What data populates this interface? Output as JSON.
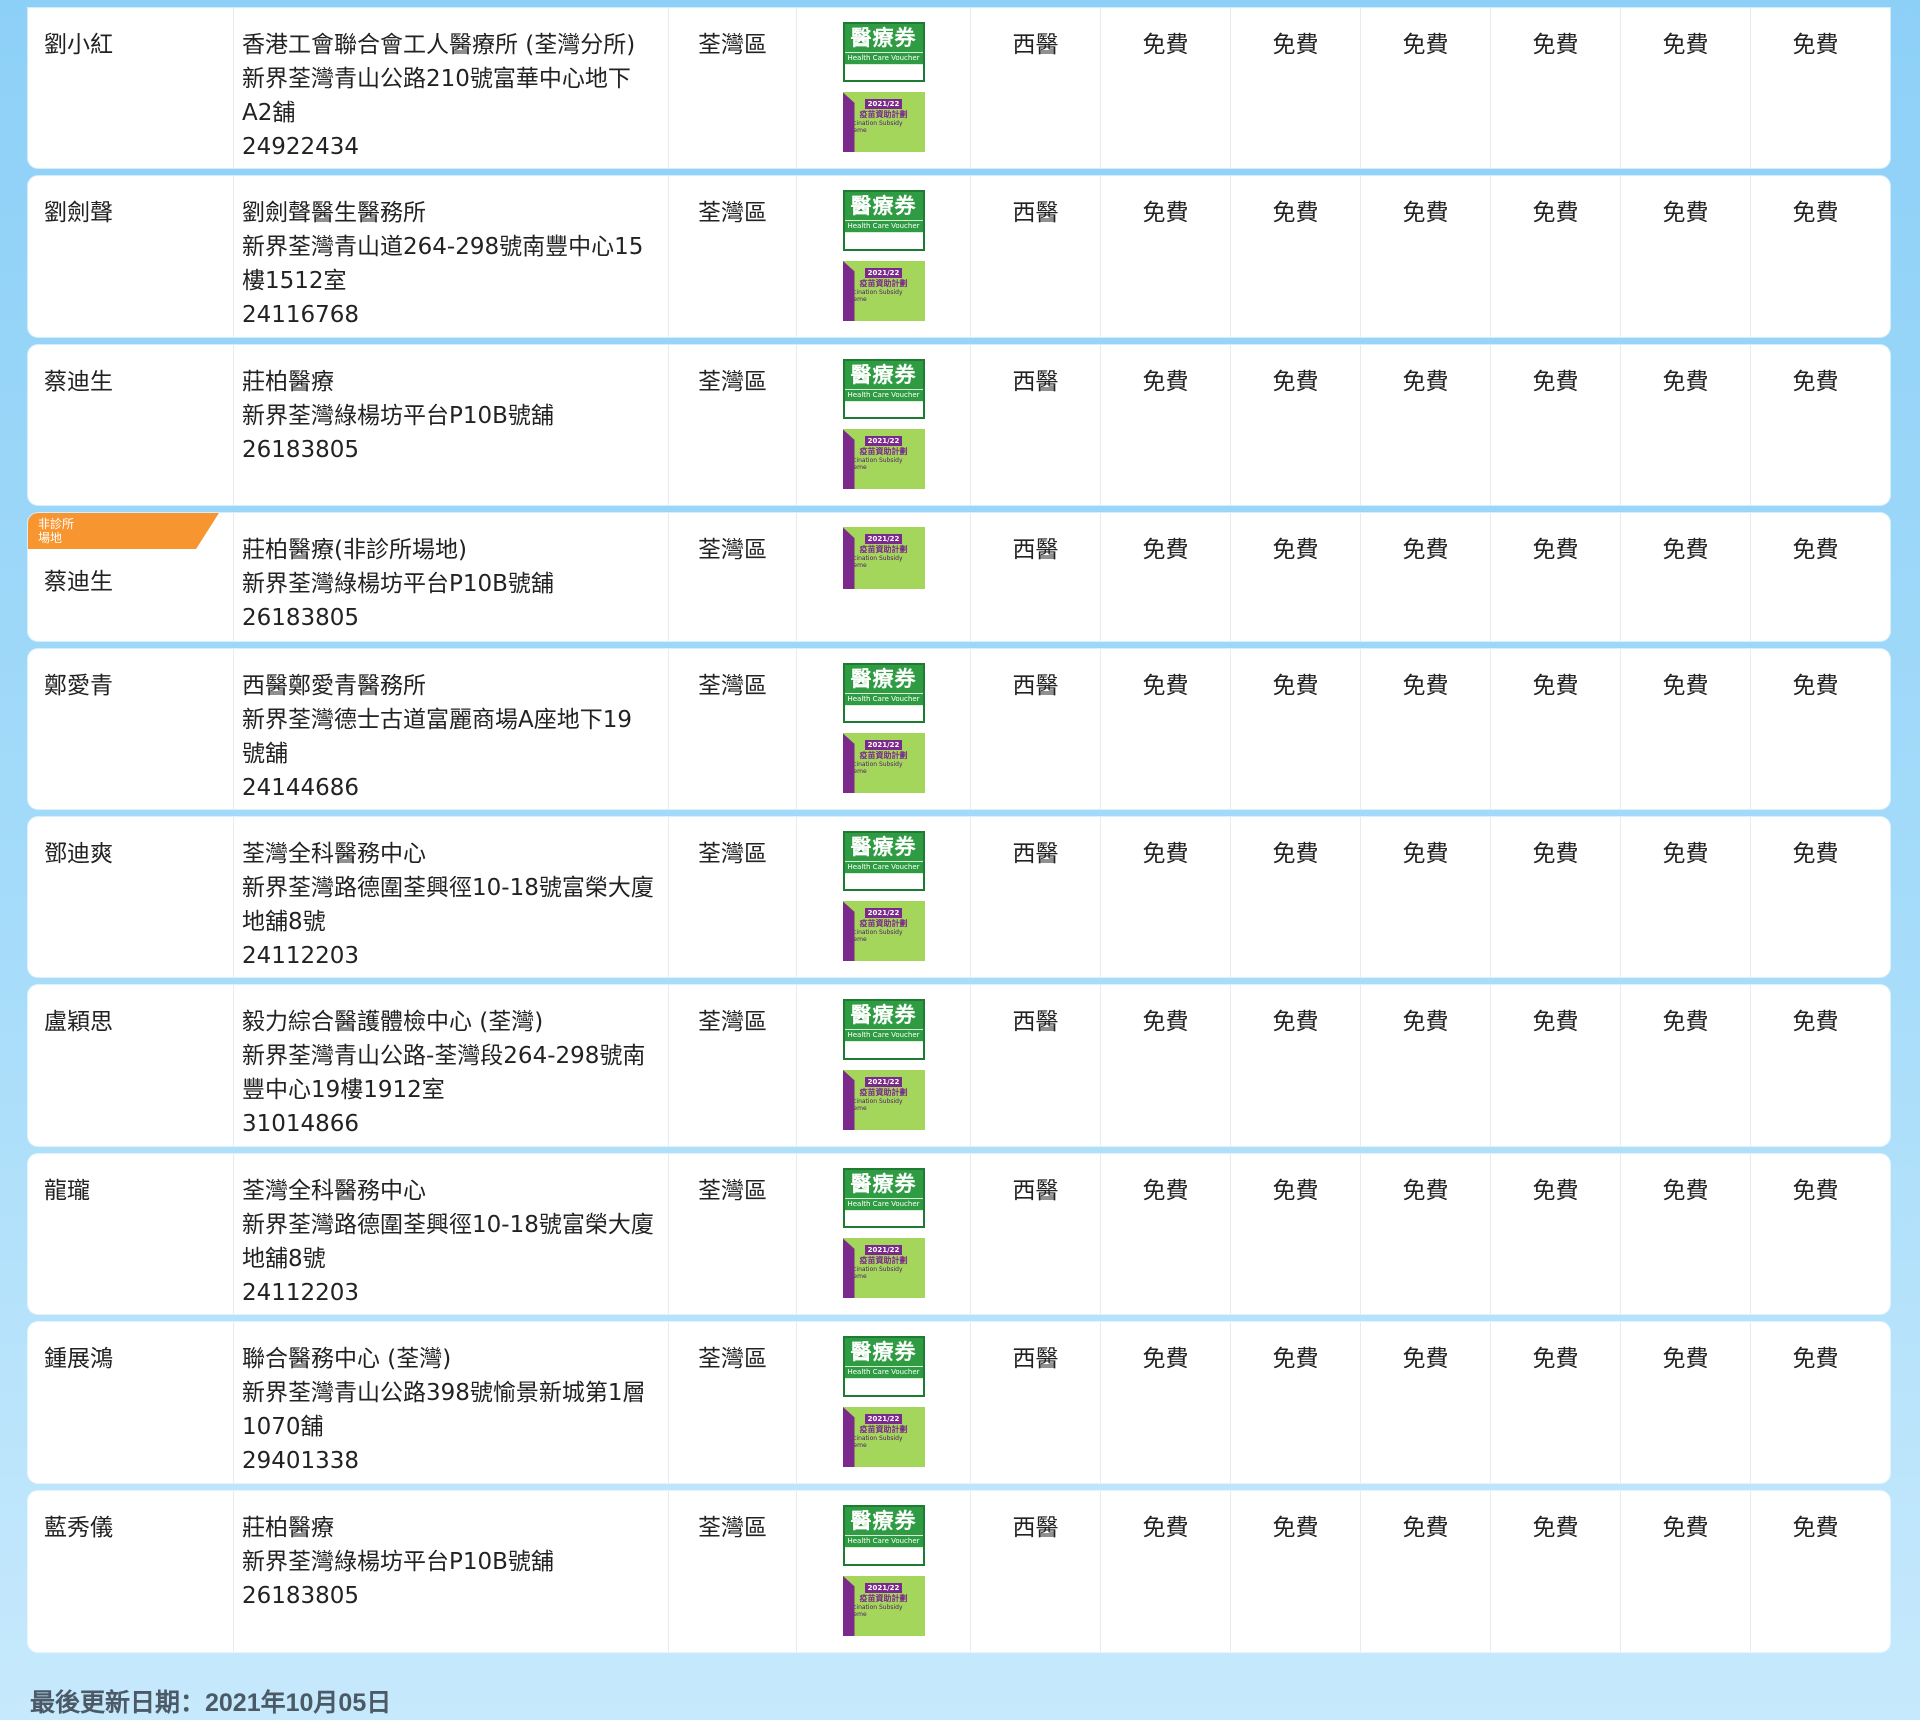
{
  "rows": [
    {
      "name": "劉小紅",
      "clinic": "香港工會聯合會工人醫療所 (荃灣分所)",
      "address": "新界荃灣青山公路210號富華中心地下A2舖",
      "phone": "24922434",
      "district": "荃灣區",
      "hcv": true,
      "vss": true,
      "non_clinic": false,
      "type": "西醫",
      "fees": [
        "免費",
        "免費",
        "免費",
        "免費",
        "免費",
        "免費"
      ]
    },
    {
      "name": "劉劍聲",
      "clinic": "劉劍聲醫生醫務所",
      "address": "新界荃灣青山道264-298號南豐中心15樓1512室",
      "phone": "24116768",
      "district": "荃灣區",
      "hcv": true,
      "vss": true,
      "non_clinic": false,
      "type": "西醫",
      "fees": [
        "免費",
        "免費",
        "免費",
        "免費",
        "免費",
        "免費"
      ]
    },
    {
      "name": "蔡迪生",
      "clinic": "莊柏醫療",
      "address": "新界荃灣綠楊坊平台P10B號舖",
      "phone": "26183805",
      "district": "荃灣區",
      "hcv": true,
      "vss": true,
      "non_clinic": false,
      "type": "西醫",
      "fees": [
        "免費",
        "免費",
        "免費",
        "免費",
        "免費",
        "免費"
      ]
    },
    {
      "name": "蔡迪生",
      "clinic": "莊柏醫療(非診所場地)",
      "address": "新界荃灣綠楊坊平台P10B號舖",
      "phone": "26183805",
      "district": "荃灣區",
      "hcv": false,
      "vss": true,
      "non_clinic": true,
      "type": "西醫",
      "fees": [
        "免費",
        "免費",
        "免費",
        "免費",
        "免費",
        "免費"
      ]
    },
    {
      "name": "鄭愛青",
      "clinic": "西醫鄭愛青醫務所",
      "address": "新界荃灣德士古道富麗商場A座地下19號舖",
      "phone": "24144686",
      "district": "荃灣區",
      "hcv": true,
      "vss": true,
      "non_clinic": false,
      "type": "西醫",
      "fees": [
        "免費",
        "免費",
        "免費",
        "免費",
        "免費",
        "免費"
      ]
    },
    {
      "name": "鄧迪爽",
      "clinic": "荃灣全科醫務中心",
      "address": "新界荃灣路德圍荃興徑10-18號富榮大廈地舖8號",
      "phone": "24112203",
      "district": "荃灣區",
      "hcv": true,
      "vss": true,
      "non_clinic": false,
      "type": "西醫",
      "fees": [
        "免費",
        "免費",
        "免費",
        "免費",
        "免費",
        "免費"
      ]
    },
    {
      "name": "盧穎思",
      "clinic": "毅力綜合醫護體檢中心 (荃灣)",
      "address": "新界荃灣青山公路-荃灣段264-298號南豐中心19樓1912室",
      "phone": "31014866",
      "district": "荃灣區",
      "hcv": true,
      "vss": true,
      "non_clinic": false,
      "type": "西醫",
      "fees": [
        "免費",
        "免費",
        "免費",
        "免費",
        "免費",
        "免費"
      ]
    },
    {
      "name": "龍瓏",
      "clinic": "荃灣全科醫務中心",
      "address": "新界荃灣路德圍荃興徑10-18號富榮大廈地舖8號",
      "phone": "24112203",
      "district": "荃灣區",
      "hcv": true,
      "vss": true,
      "non_clinic": false,
      "type": "西醫",
      "fees": [
        "免費",
        "免費",
        "免費",
        "免費",
        "免費",
        "免費"
      ]
    },
    {
      "name": "鍾展鴻",
      "clinic": "聯合醫務中心 (荃灣)",
      "address": "新界荃灣青山公路398號愉景新城第1層1070舖",
      "phone": "29401338",
      "district": "荃灣區",
      "hcv": true,
      "vss": true,
      "non_clinic": false,
      "type": "西醫",
      "fees": [
        "免費",
        "免費",
        "免費",
        "免費",
        "免費",
        "免費"
      ]
    },
    {
      "name": "藍秀儀",
      "clinic": "莊柏醫療",
      "address": "新界荃灣綠楊坊平台P10B號舖",
      "phone": "26183805",
      "district": "荃灣區",
      "hcv": true,
      "vss": true,
      "non_clinic": false,
      "type": "西醫",
      "fees": [
        "免費",
        "免費",
        "免費",
        "免費",
        "免費",
        "免費"
      ]
    }
  ],
  "badges": {
    "non_clinic_label": "非診所\n場地",
    "hcv_title": "醫療券",
    "hcv_sub": "Health Care Voucher",
    "vss_year": "2021/22",
    "vss_name": "疫苗資助計劃",
    "vss_en": "Vaccination Subsidy Scheme"
  },
  "footer": {
    "last_updated": "最後更新日期：2021年10月05日"
  },
  "colors": {
    "accent_orange": "#f79530",
    "hcv_green": "#2f9b43",
    "vss_green": "#a5d65c",
    "vss_purple": "#7b2a8c"
  }
}
